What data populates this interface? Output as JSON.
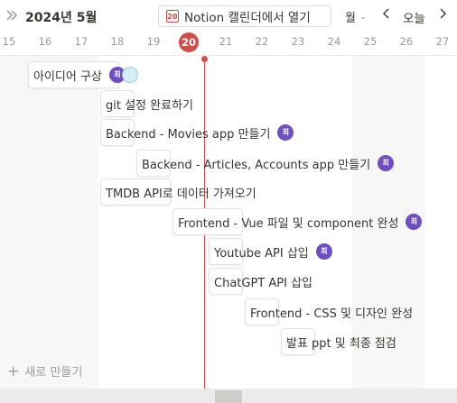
{
  "header": {
    "month_label": "2024년 5월",
    "open_button_label": "Notion 캘린더에서 열기",
    "calendar_icon_number": "20",
    "view_select": "월",
    "today_label": "오늘"
  },
  "days": [
    "15",
    "16",
    "17",
    "18",
    "19",
    "20",
    "21",
    "22",
    "23",
    "24",
    "25",
    "26",
    "27"
  ],
  "today": "20",
  "tasks": [
    {
      "label": "아이디어 구상",
      "avatar": "최",
      "second_avatar": true
    },
    {
      "label": "git 설정 완료하기"
    },
    {
      "label": "Backend - Movies app 만들기",
      "avatar": "최"
    },
    {
      "label": "Backend - Articles, Accounts app 만들기",
      "avatar": "최"
    },
    {
      "label": "TMDB API로 데이터 가져오기"
    },
    {
      "label": "Frontend - Vue 파일 및 component 완성",
      "avatar": "최"
    },
    {
      "label": "Youtube API 삽입",
      "avatar": "최"
    },
    {
      "label": "ChatGPT API 삽입"
    },
    {
      "label": "Frontend - CSS 및 디자인 완성"
    },
    {
      "label": "발표 ppt 및 최종 점검"
    }
  ],
  "new_button_label": "새로 만들기",
  "colors": {
    "accent": "#d44c47",
    "avatar": "#6d4fc1",
    "weekend": "#f7f7f5"
  }
}
